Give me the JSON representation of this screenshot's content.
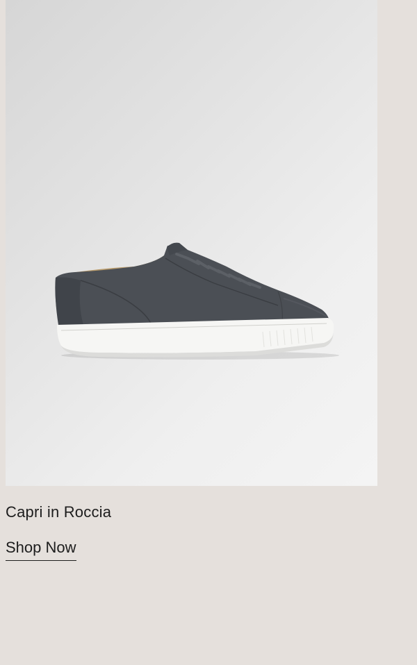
{
  "product": {
    "name": "Capri in Roccia",
    "cta_label": "Shop Now",
    "image_subject": "sneaker-image"
  },
  "colors": {
    "page_background": "#e5e0dc",
    "image_background": "#e8e8e8",
    "suede": "#4b4f55",
    "sole": "#f6f6f4",
    "lining": "#b89a6a",
    "text": "#1d1d1d"
  }
}
